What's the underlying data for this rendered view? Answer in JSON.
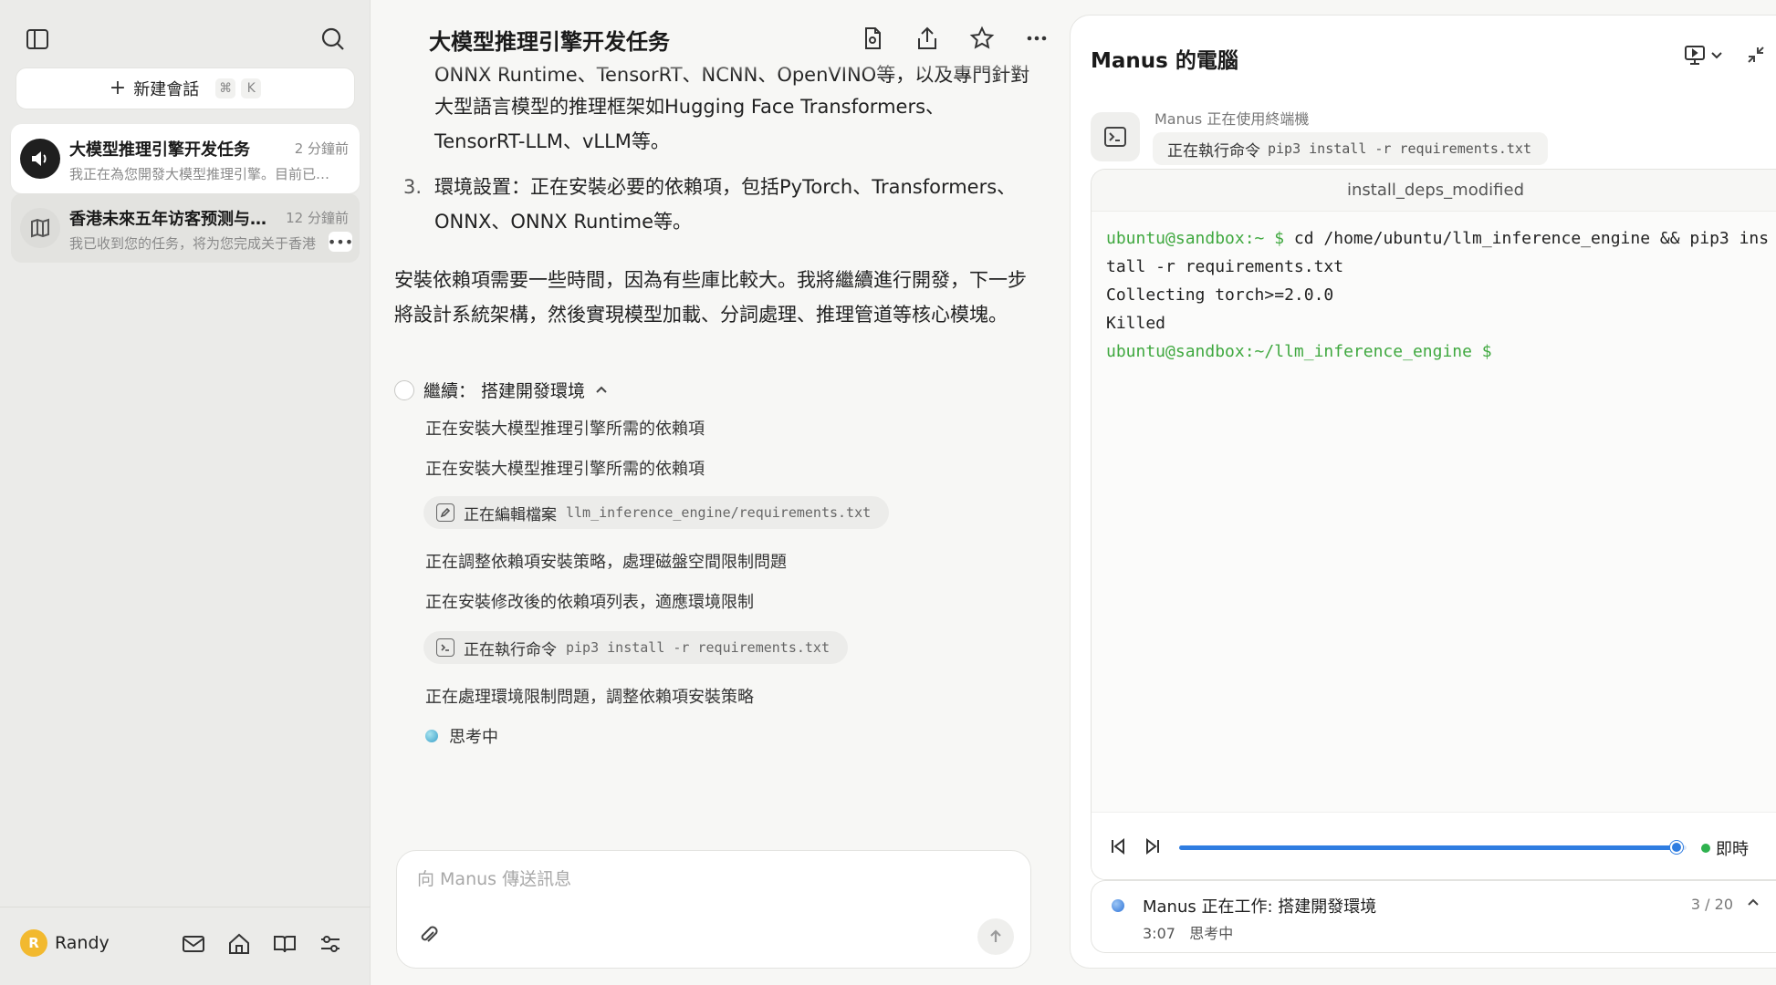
{
  "sidebar": {
    "new_chat_label": "新建會話",
    "shortcut_keys": [
      "⌘",
      "K"
    ],
    "conversations": [
      {
        "title": "大模型推理引擎开发任务",
        "time": "2 分鐘前",
        "preview": "我正在為您開發大模型推理引擎。目前已…"
      },
      {
        "title": "香港未來五年访客预测与…",
        "time": "12 分鐘前",
        "preview": "我已收到您的任务，将为您完成关于香港"
      }
    ],
    "user": {
      "initial": "R",
      "name": "Randy"
    }
  },
  "chat": {
    "title": "大模型推理引擎开发任务",
    "cut_line": "ONNX Runtime、TensorRT、NCNN、OpenVINO等，以及專門針對",
    "list_item2_cont": "大型語言模型的推理框架如Hugging Face Transformers、TensorRT-LLM、vLLM等。",
    "list_item3_num": "3.",
    "list_item3": "環境設置：正在安裝必要的依賴項，包括PyTorch、Transformers、ONNX、ONNX Runtime等。",
    "paragraph": "安裝依賴項需要一些時間，因為有些庫比較大。我將繼續進行開發，下一步將設計系統架構，然後實現模型加載、分詞處理、推理管道等核心模塊。",
    "step": {
      "label": "繼續：  搭建開發環境",
      "lines": [
        "正在安裝大模型推理引擎所需的依賴項",
        "正在安裝大模型推理引擎所需的依賴項",
        "正在調整依賴項安裝策略，處理磁盤空間限制問題",
        "正在安裝修改後的依賴項列表，適應環境限制",
        "正在處理環境限制問題，調整依賴項安裝策略"
      ],
      "tool1": {
        "action": "正在編輯檔案",
        "arg": "llm_inference_engine/requirements.txt"
      },
      "tool2": {
        "action": "正在執行命令",
        "arg": "pip3 install -r requirements.txt"
      },
      "thinking": "思考中"
    },
    "composer": {
      "placeholder": "向 Manus 傳送訊息"
    }
  },
  "panel": {
    "title": "Manus 的電腦",
    "using_label": "Manus 正在使用終端機",
    "using_action": "正在執行命令",
    "using_arg": "pip3 install -r requirements.txt",
    "terminal": {
      "name": "install_deps_modified",
      "lines": [
        {
          "prompt": "ubuntu@sandbox:~ $",
          "text": " cd /home/ubuntu/llm_inference_engine && pip3 install -r requirements.txt"
        },
        {
          "prompt": "",
          "text": "Collecting torch>=2.0.0"
        },
        {
          "prompt": "",
          "text": "Killed"
        },
        {
          "prompt": "ubuntu@sandbox:~/llm_inference_engine $",
          "text": ""
        }
      ]
    },
    "playback": {
      "progress": 0.98,
      "live_label": "即時"
    },
    "status": {
      "title": "Manus 正在工作: 搭建開發環境",
      "time": "3:07",
      "sub": "思考中",
      "progress": "3 / 20"
    }
  }
}
